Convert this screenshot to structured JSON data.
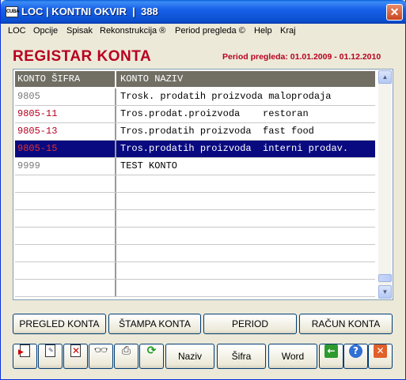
{
  "window": {
    "icon_text": "CUBA",
    "title": "LOC | KONTNI OKVIR  |  388",
    "close_label": "✕"
  },
  "menu": [
    "LOC",
    "Opcije",
    "Spisak",
    "Rekonstrukcija ®",
    "Period pregleda ©",
    "Help",
    "Kraj"
  ],
  "heading": "REGISTAR KONTA",
  "period": "Period pregleda: 01.01.2009 - 01.12.2010",
  "table": {
    "columns": [
      "KONTO ŠIFRA",
      "KONTO NAZIV"
    ],
    "rows": [
      {
        "sifra": "9805",
        "naziv": "Trosk. prodatih proizvoda maloprodaja",
        "color": "#777777"
      },
      {
        "sifra": "9805-11",
        "naziv": "Tros.prodat.proizvoda    restoran",
        "color": "#b8001f"
      },
      {
        "sifra": "9805-13",
        "naziv": "Tros.prodatih proizvoda  fast food",
        "color": "#b8001f"
      },
      {
        "sifra": "9805-15",
        "naziv": "Tros.prodatih proizvoda  interni prodav.",
        "color": "#e03030"
      },
      {
        "sifra": "9999",
        "naziv": "TEST KONTO",
        "color": "#777777"
      }
    ],
    "selected_row": 3,
    "empty_rows": 7
  },
  "buttons": {
    "pregled": "PREGLED KONTA",
    "stampa": "ŠTAMPA KONTA",
    "period": "PERIOD",
    "racun": "RAČUN KONTA",
    "naziv": "Naziv",
    "sifra": "Šifra",
    "word": "Word"
  },
  "icons": [
    "new-document-icon",
    "edit-document-icon",
    "delete-document-icon",
    "find-glasses-icon",
    "printer-icon",
    "refresh-icon",
    "back-arrow-icon",
    "help-icon",
    "exit-icon"
  ]
}
